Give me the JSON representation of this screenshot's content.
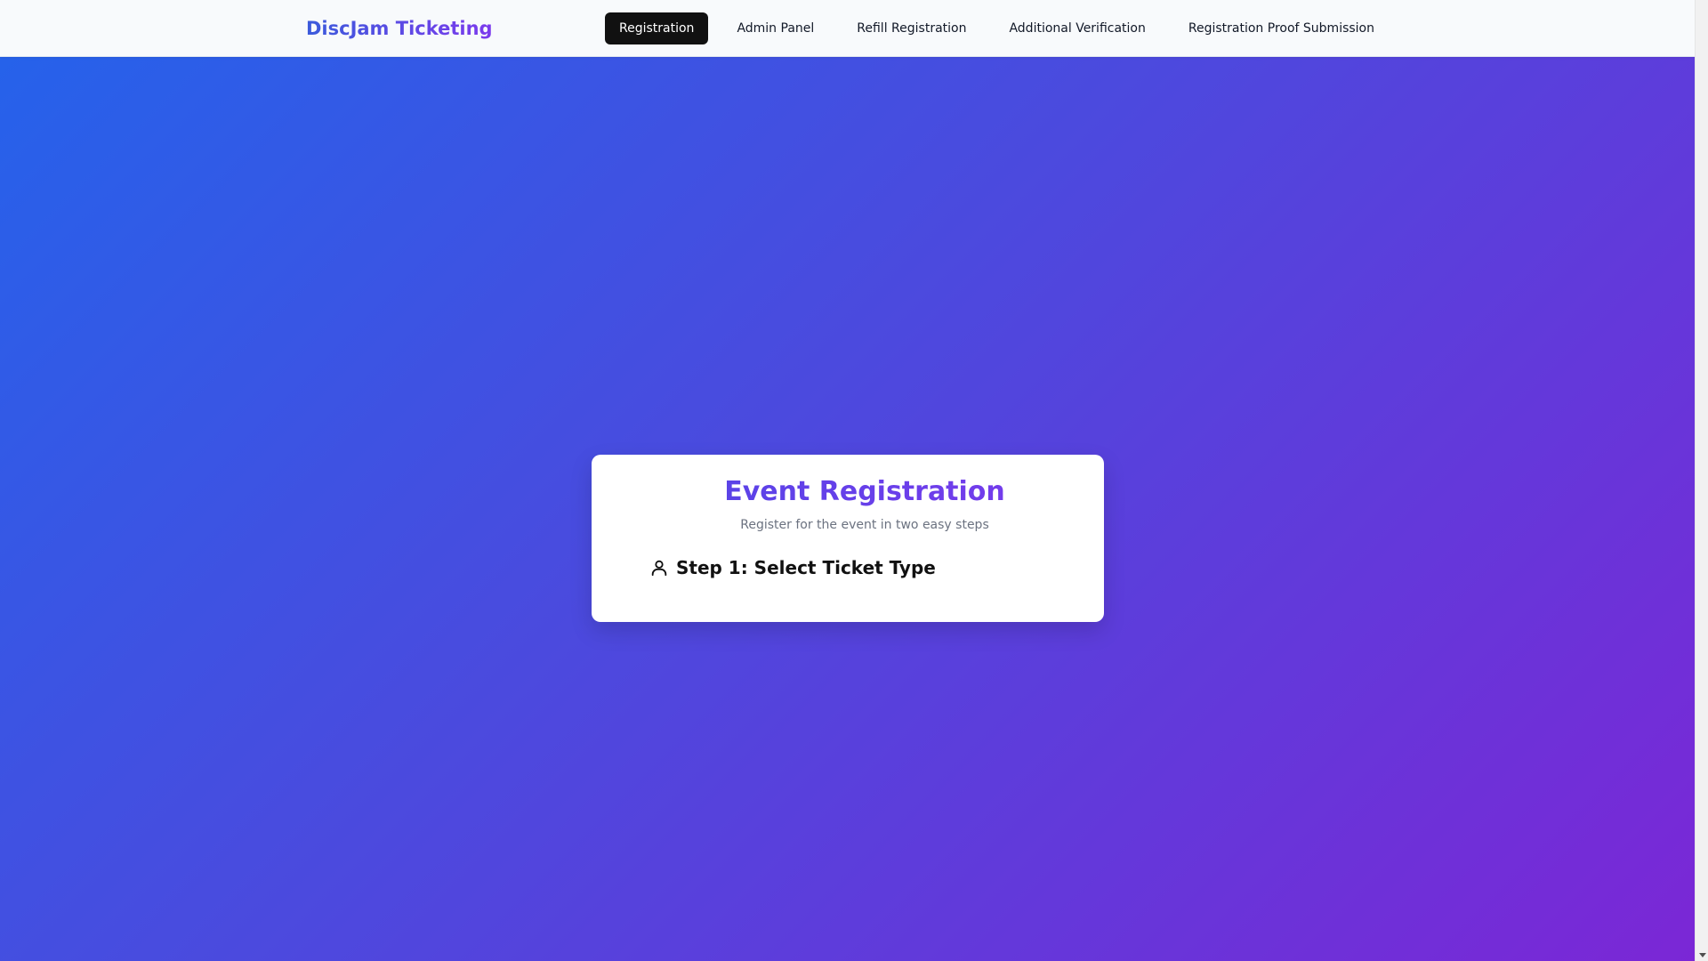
{
  "brand": {
    "name": "DiscJam Ticketing"
  },
  "nav": {
    "items": [
      {
        "label": "Registration",
        "active": true
      },
      {
        "label": "Admin Panel",
        "active": false
      },
      {
        "label": "Refill Registration",
        "active": false
      },
      {
        "label": "Additional Verification",
        "active": false
      },
      {
        "label": "Registration Proof Submission",
        "active": false
      }
    ]
  },
  "card": {
    "title": "Event Registration",
    "subtitle": "Register for the event in two easy steps",
    "step": {
      "icon": "user-icon",
      "label": "Step 1: Select Ticket Type"
    }
  },
  "colors": {
    "bg_gradient_start": "#2463eb",
    "bg_gradient_end": "#7b27d6",
    "nav_active_bg": "#111111",
    "brand_gradient_start": "#3b5bdb",
    "brand_gradient_end": "#7c3aed"
  }
}
